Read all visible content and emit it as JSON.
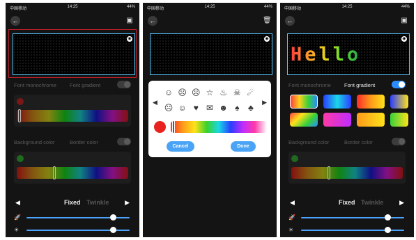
{
  "status": {
    "carrier": "中国移动",
    "time": "14:25",
    "battery": "44%"
  },
  "icons": {
    "back": "←",
    "save": "▣",
    "delete": "🗑",
    "eye": "◉"
  },
  "screen1": {
    "font_mono": "Font monochrome",
    "font_gradient": "Font gradient",
    "bg_color": "Background color",
    "border_color": "Border color",
    "font_dot_color": "#7a1818",
    "bg_dot_color": "#1f6a1f"
  },
  "screen2": {
    "emoji_row1": [
      "☺",
      "☹",
      "☹",
      "☆",
      "♨",
      "☠",
      "☄"
    ],
    "emoji_row2": [
      "☹",
      "☺",
      "♥",
      "✉",
      "☻",
      "♠",
      "♣"
    ],
    "cancel": "Cancel",
    "done": "Done"
  },
  "screen3": {
    "hello_text": "Hello",
    "font_mono": "Font monochrome",
    "font_gradient": "Font gradient",
    "bg_color": "Background color",
    "border_color": "Border color",
    "gradients": [
      "linear-gradient(90deg,#ff4040,#ffd21a,#38d13a,#2a8cff)",
      "linear-gradient(90deg,#2a3dff,#1ad7e6,#2a3dff)",
      "linear-gradient(90deg,#ff2a2a,#ff9a1a,#ffe21a)",
      "linear-gradient(90deg,#2a3dff,#ffe21a)",
      "linear-gradient(135deg,#ff4040,#ffe21a,#38d13a,#2a8cff)",
      "linear-gradient(90deg,#ff3aa8,#c02cff)",
      "linear-gradient(90deg,#ff9a1a,#ffe21a)",
      "linear-gradient(90deg,#38d13a,#ffe21a)"
    ],
    "font_dot_color": "#1f4a8a",
    "bg_dot_color": "#1f6a1f"
  },
  "mode": {
    "fixed": "Fixed",
    "twinkle": "Twinkle",
    "left": "◀",
    "right": "▶"
  },
  "sliders": {
    "speed_icon": "🚀",
    "bright_icon": "☀",
    "speed": 0.86,
    "brightness": 0.86
  }
}
